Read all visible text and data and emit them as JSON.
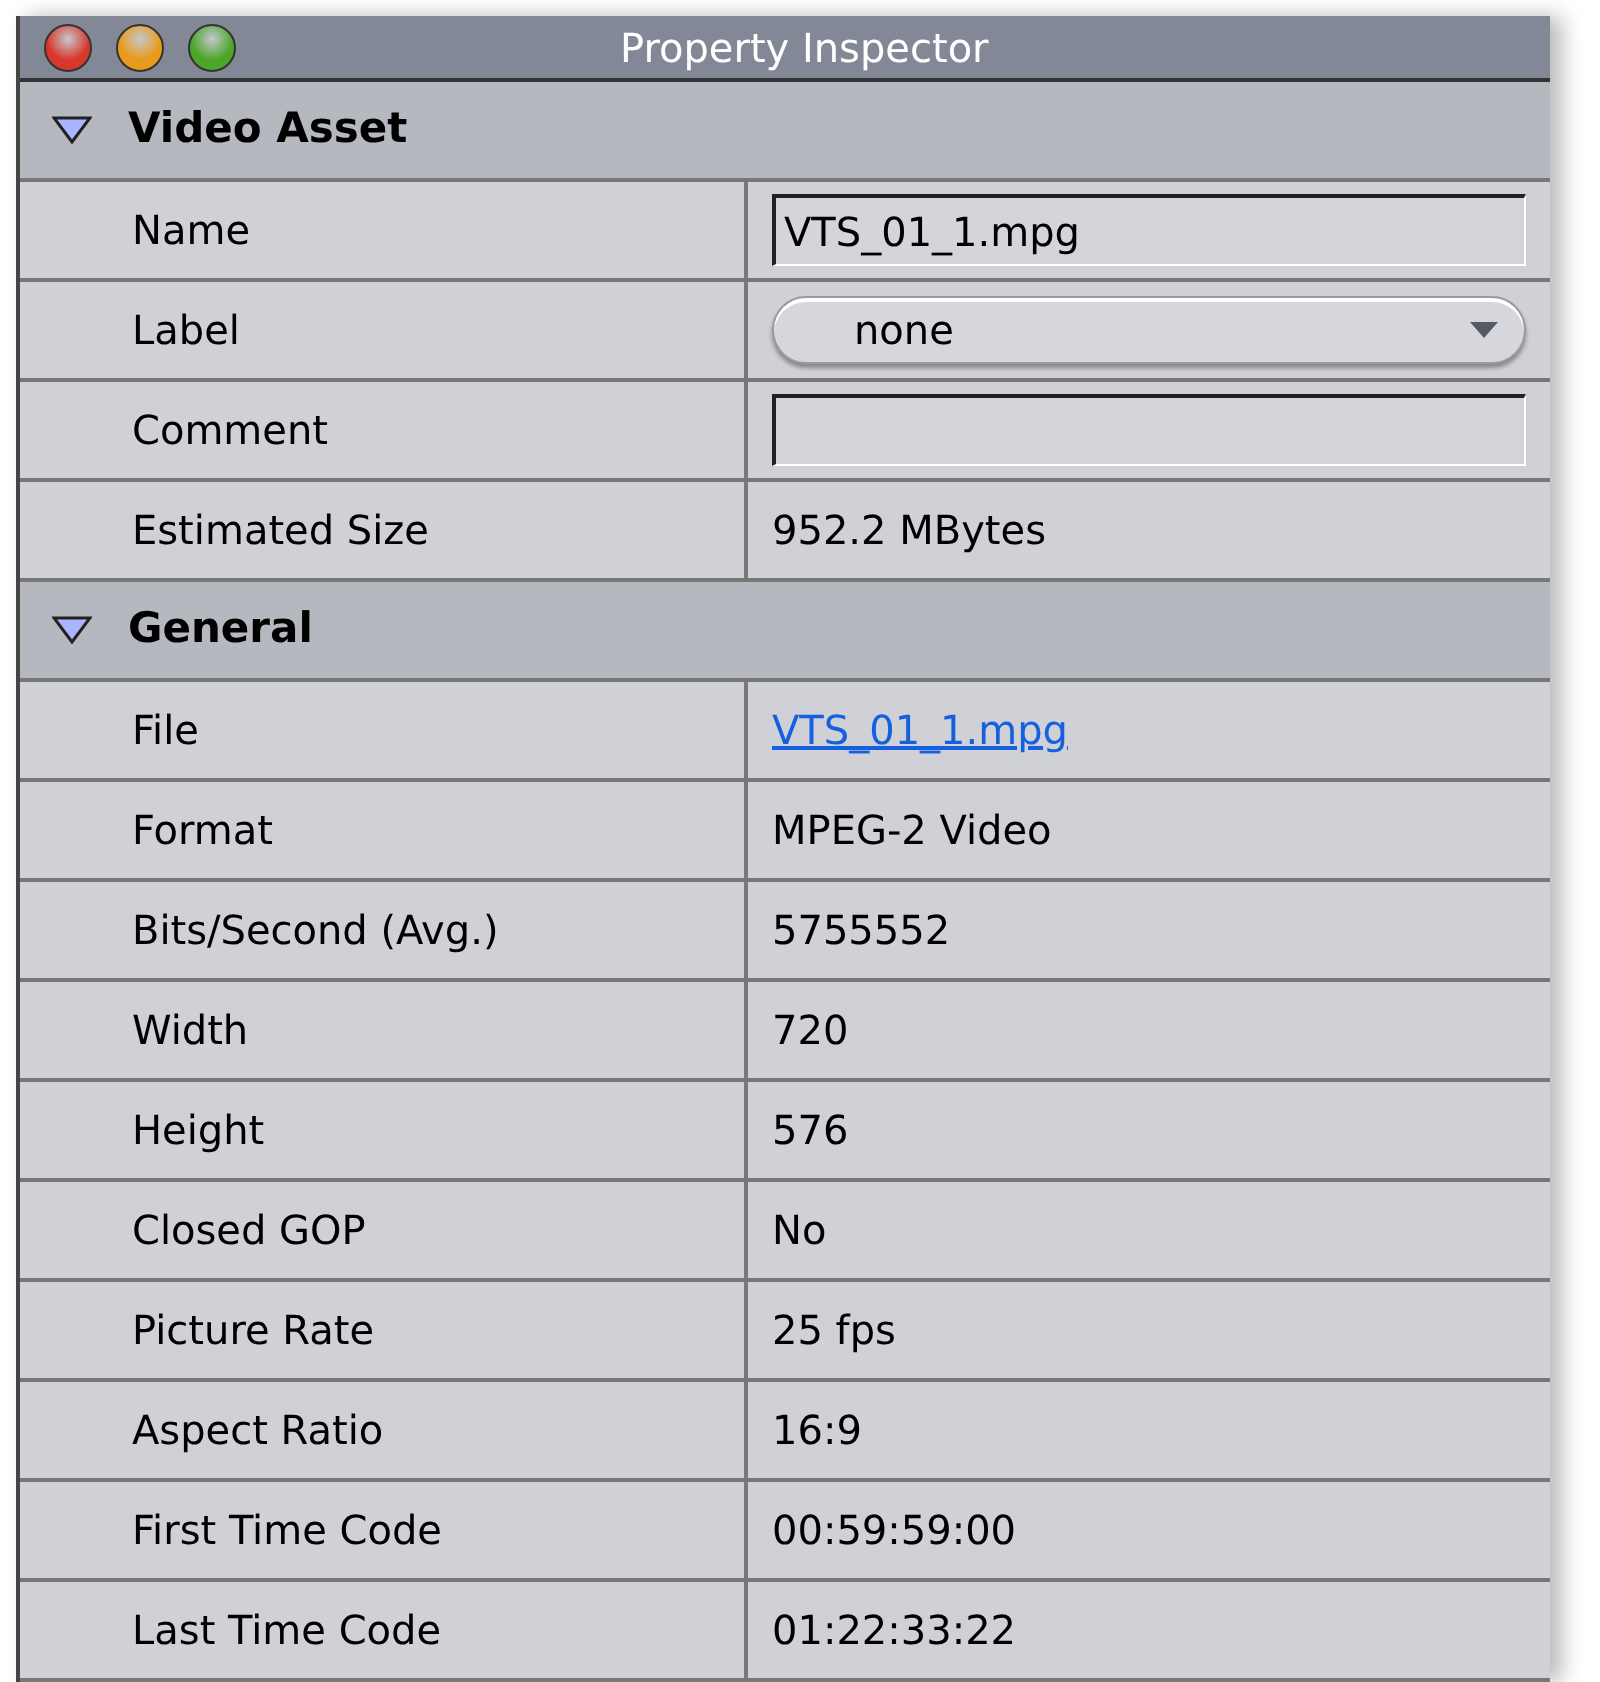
{
  "window": {
    "title": "Property Inspector"
  },
  "sections": [
    {
      "title": "Video Asset",
      "expanded": true,
      "rows": [
        {
          "label": "Name",
          "kind": "input",
          "value": "VTS_01_1.mpg"
        },
        {
          "label": "Label",
          "kind": "select",
          "value": "none"
        },
        {
          "label": "Comment",
          "kind": "input"
        },
        {
          "label": "Estimated Size",
          "kind": "text",
          "value": "952.2 MBytes"
        }
      ]
    },
    {
      "title": "General",
      "expanded": true,
      "rows": [
        {
          "label": "File",
          "kind": "link",
          "value": "VTS_01_1.mpg"
        },
        {
          "label": "Format",
          "kind": "text",
          "value": "MPEG-2 Video"
        },
        {
          "label": "Bits/Second (Avg.)",
          "kind": "text",
          "value": "5755552"
        },
        {
          "label": "Width",
          "kind": "text",
          "value": "720"
        },
        {
          "label": "Height",
          "kind": "text",
          "value": "576"
        },
        {
          "label": "Closed GOP",
          "kind": "text",
          "value": "No"
        },
        {
          "label": "Picture Rate",
          "kind": "text",
          "value": "25 fps"
        },
        {
          "label": "Aspect Ratio",
          "kind": "text",
          "value": "16:9"
        },
        {
          "label": "First Time Code",
          "kind": "text",
          "value": "00:59:59:00"
        },
        {
          "label": "Last Time Code",
          "kind": "text",
          "value": "01:22:33:22"
        }
      ]
    }
  ]
}
